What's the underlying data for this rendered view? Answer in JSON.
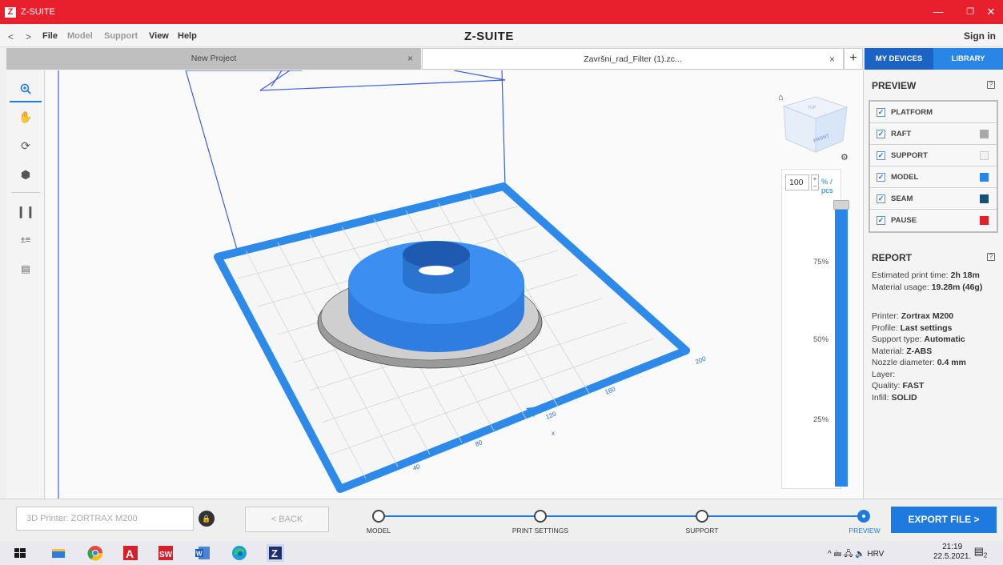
{
  "window": {
    "logo": "Z",
    "title": "Z-SUITE",
    "minimize": "—",
    "restore": "❐",
    "close": "✕"
  },
  "menubar": {
    "back": "<",
    "forward": ">",
    "items": [
      {
        "label": "File",
        "enabled": true
      },
      {
        "label": "Model",
        "enabled": false
      },
      {
        "label": "Support",
        "enabled": false
      },
      {
        "label": "View",
        "enabled": true
      },
      {
        "label": "Help",
        "enabled": true
      }
    ],
    "brand": "Z-SUITE",
    "signin": "Sign in"
  },
  "tabs": [
    {
      "label": "New Project",
      "close": "×"
    },
    {
      "label": "Završni_rad_Filter (1).zc...",
      "close": "×"
    }
  ],
  "add_tab": "+",
  "side_tabs": {
    "devices": "MY DEVICES",
    "library": "LIBRARY"
  },
  "preview": {
    "title": "PREVIEW",
    "help": "?",
    "layers": [
      {
        "label": "PLATFORM",
        "checked": true,
        "color": ""
      },
      {
        "label": "RAFT",
        "checked": true,
        "color": "#a8a8a8"
      },
      {
        "label": "SUPPORT",
        "checked": true,
        "color": "#f2f2f2"
      },
      {
        "label": "MODEL",
        "checked": true,
        "color": "#2a86e6"
      },
      {
        "label": "SEAM",
        "checked": true,
        "color": "#1a4f78"
      },
      {
        "label": "PAUSE",
        "checked": true,
        "color": "#e0202a"
      }
    ]
  },
  "report": {
    "title": "REPORT",
    "help": "?",
    "print_time_label": "Estimated print time:",
    "print_time": "2h 18m",
    "material_usage_label": "Material usage:",
    "material_usage": "19.28m (46g)",
    "printer_label": "Printer:",
    "printer": "Zortrax M200",
    "profile_label": "Profile:",
    "profile": "Last settings",
    "support_type_label": "Support type:",
    "support_type": "Automatic",
    "material_label": "Material:",
    "material": "Z-ABS",
    "nozzle_label": "Nozzle diameter:",
    "nozzle": "0.4 mm",
    "layer_label": "Layer:",
    "quality_label": "Quality:",
    "quality": "FAST",
    "infill_label": "Infill:",
    "infill": "SOLID"
  },
  "slider": {
    "value": "100",
    "unit": "% / pcs",
    "level": 1.0,
    "ticks": [
      "75%",
      "50%",
      "25%"
    ]
  },
  "viewport": {
    "axis_numbers": [
      "40",
      "80",
      "120",
      "160",
      "200"
    ],
    "axis_label": "x",
    "viewcube_top": "TOP",
    "viewcube_front": "FRONT"
  },
  "bottom": {
    "printer_placeholder": "3D Printer: ZORTRAX M200",
    "back": "< BACK",
    "steps": [
      "MODEL",
      "PRINT SETTINGS",
      "SUPPORT",
      "PREVIEW"
    ],
    "export": "EXPORT FILE >"
  },
  "taskbar": {
    "tray": "^ 🖮 🖧 🔈 HRV",
    "time": "21:19",
    "date": "22.5.2021.",
    "notifications": "2"
  },
  "colors": {
    "accent": "#1f7ae0",
    "titlebar": "#e81f2c",
    "model": "#2a86e6"
  }
}
